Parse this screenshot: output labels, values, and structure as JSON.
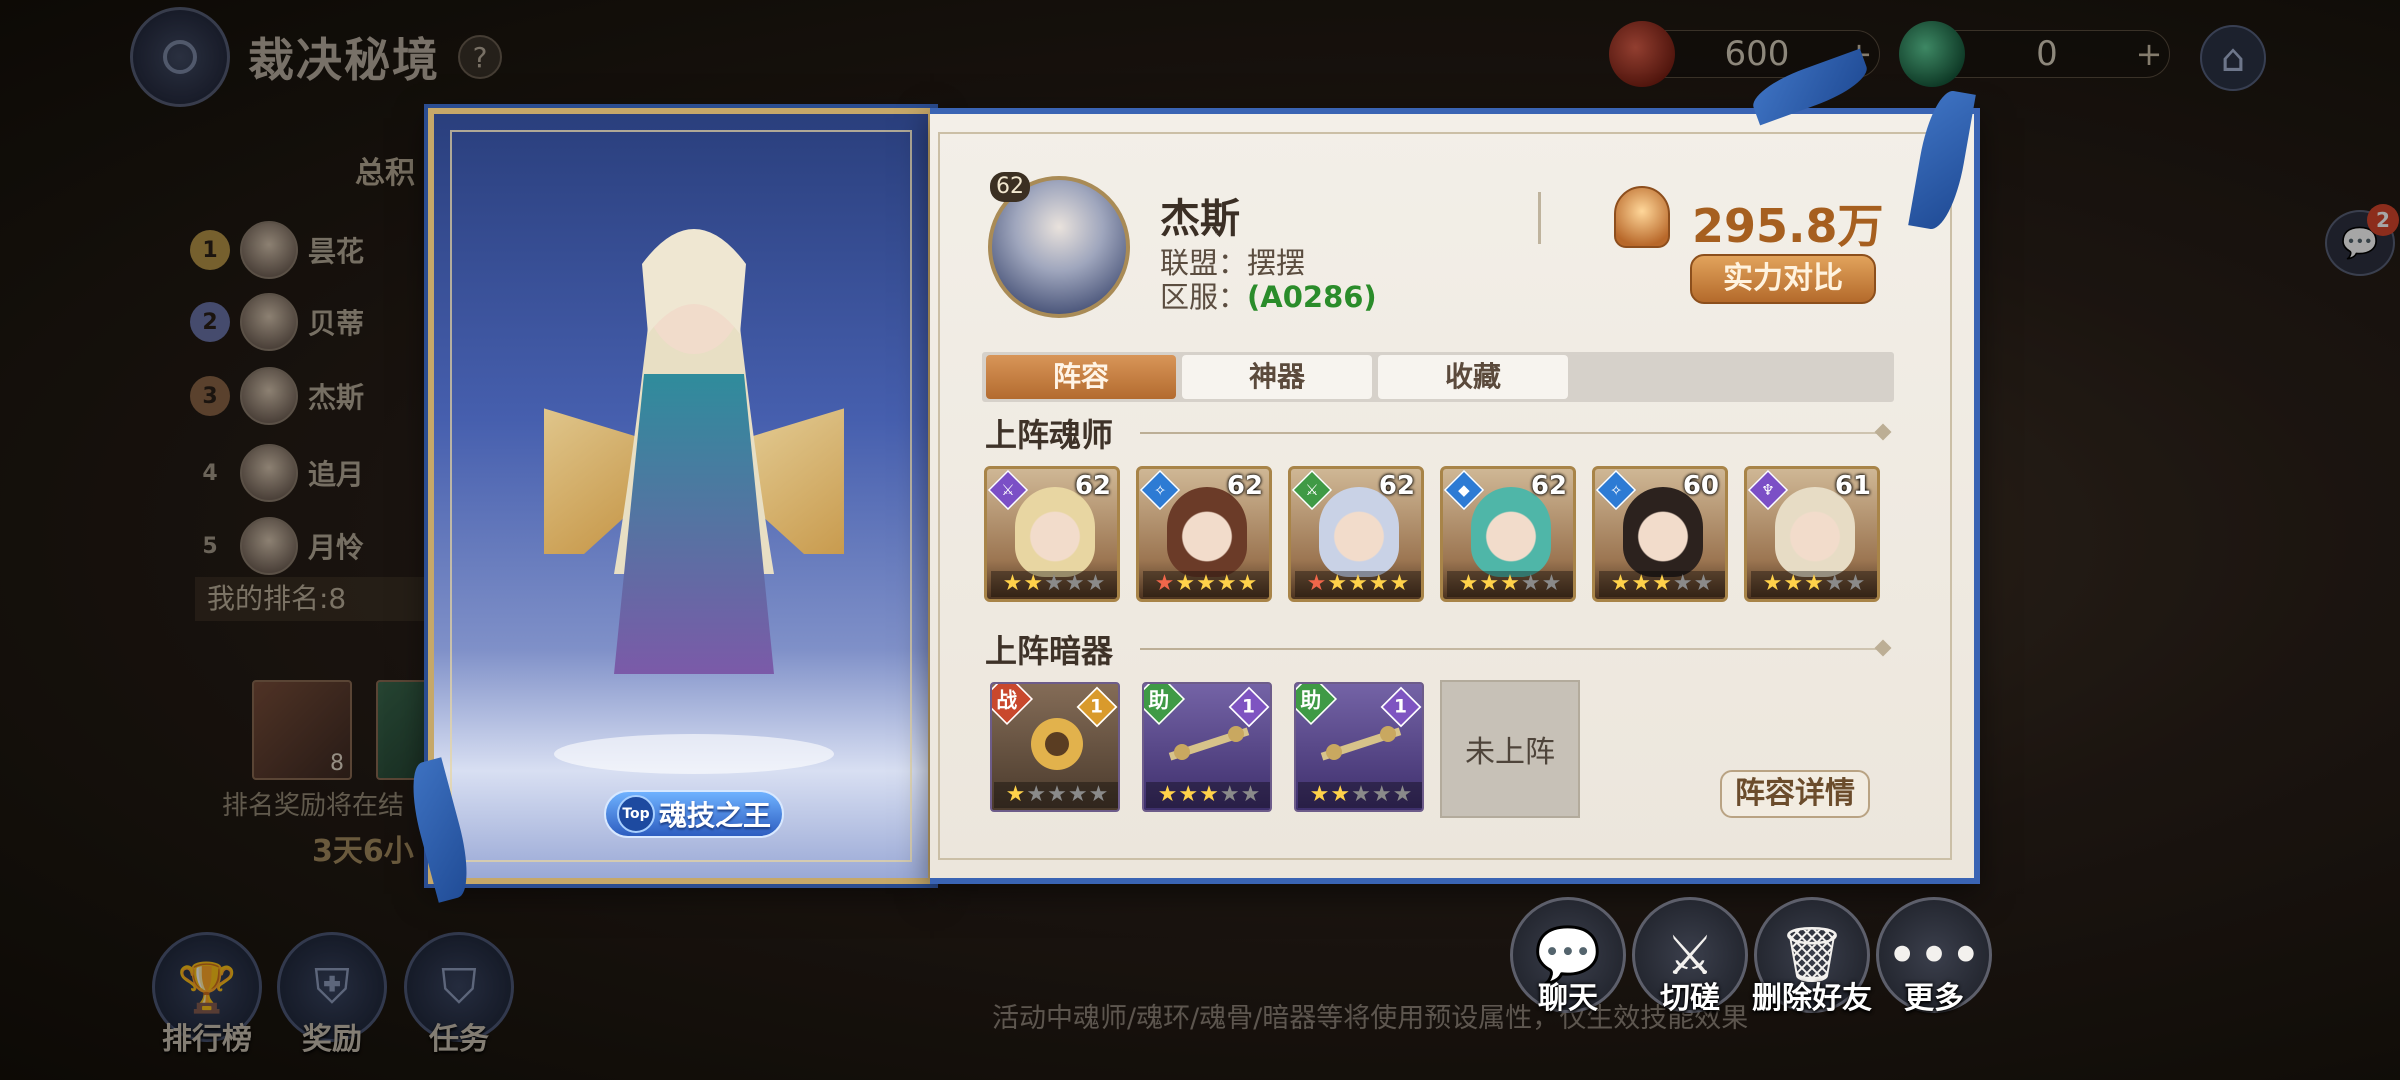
{
  "background": {
    "title": "裁决秘境",
    "help": "?",
    "currencies": [
      {
        "value": "600",
        "plus": "+",
        "icon": "red-gem-icon"
      },
      {
        "value": "0",
        "plus": "+",
        "icon": "green-gem-icon"
      }
    ],
    "chat_badge": "2",
    "ranking": {
      "title": "总积",
      "rows": [
        {
          "rank": "1",
          "name": "昙花"
        },
        {
          "rank": "2",
          "name": "贝蒂"
        },
        {
          "rank": "3",
          "name": "杰斯"
        },
        {
          "rank": "4",
          "name": "追月"
        },
        {
          "rank": "5",
          "name": "月怜"
        }
      ],
      "my_rank": "我的排名:8"
    },
    "reward_count": "8",
    "reward_note": "排名奖励将在结",
    "reward_time": "3天6小",
    "bottom_nav": [
      {
        "label": "排行榜",
        "icon": "trophy-icon"
      },
      {
        "label": "奖励",
        "icon": "armor-icon"
      },
      {
        "label": "任务",
        "icon": "shield-icon"
      }
    ],
    "footer_note": "活动中魂师/魂环/魂骨/暗器等将使用预设属性，仅生效技能效果"
  },
  "card": {
    "title_badge": "Top",
    "title_text": "魂技之王"
  },
  "player": {
    "level": "62",
    "name": "杰斯",
    "alliance_label": "联盟：",
    "alliance": "摆摆",
    "server_label": "区服：",
    "server": "(A0286)",
    "power": "295.8万",
    "compare_button": "实力对比"
  },
  "tabs": [
    {
      "label": "阵容",
      "active": true
    },
    {
      "label": "神器",
      "active": false
    },
    {
      "label": "收藏",
      "active": false
    }
  ],
  "heroes_section": "上阵魂师",
  "heroes": [
    {
      "level": "62",
      "class_color": "#7b4fc6",
      "class_glyph": "⚔",
      "stars": [
        1,
        1,
        0,
        0,
        0
      ],
      "hair": "#e8d6a2"
    },
    {
      "level": "62",
      "class_color": "#2d7bd4",
      "class_glyph": "✧",
      "stars": [
        2,
        1,
        1,
        1,
        1
      ],
      "hair": "#6b3b28"
    },
    {
      "level": "62",
      "class_color": "#3f9a45",
      "class_glyph": "⚔",
      "stars": [
        2,
        1,
        1,
        1,
        1
      ],
      "hair": "#c9d2e6"
    },
    {
      "level": "62",
      "class_color": "#2d7bd4",
      "class_glyph": "◆",
      "stars": [
        1,
        1,
        1,
        0,
        0
      ],
      "hair": "#4fb6a8"
    },
    {
      "level": "60",
      "class_color": "#2d7bd4",
      "class_glyph": "✧",
      "stars": [
        1,
        1,
        1,
        0,
        0
      ],
      "hair": "#2c221e"
    },
    {
      "level": "61",
      "class_color": "#7b4fc6",
      "class_glyph": "♆",
      "stars": [
        1,
        1,
        1,
        0,
        0
      ],
      "hair": "#e7dcc5"
    }
  ],
  "weapons_section": "上阵暗器",
  "weapons": [
    {
      "type": "战",
      "type_class": "battle",
      "level": "1",
      "level_class": "gold",
      "frame": "gold",
      "stars": [
        1,
        0,
        0,
        0,
        0
      ]
    },
    {
      "type": "助",
      "type_class": "assist",
      "level": "1",
      "level_class": "purple",
      "frame": "purple",
      "stars": [
        1,
        1,
        1,
        0,
        0
      ]
    },
    {
      "type": "助",
      "type_class": "assist",
      "level": "1",
      "level_class": "purple",
      "frame": "purple",
      "stars": [
        1,
        1,
        0,
        0,
        0
      ]
    }
  ],
  "empty_weapon": "未上阵",
  "lineup_detail_button": "阵容详情",
  "actions": [
    {
      "label": "聊天",
      "icon": "chat-bubble-icon"
    },
    {
      "label": "切磋",
      "icon": "crossed-swords-icon"
    },
    {
      "label": "删除好友",
      "icon": "trash-icon"
    },
    {
      "label": "更多",
      "icon": "more-dots-icon"
    }
  ]
}
